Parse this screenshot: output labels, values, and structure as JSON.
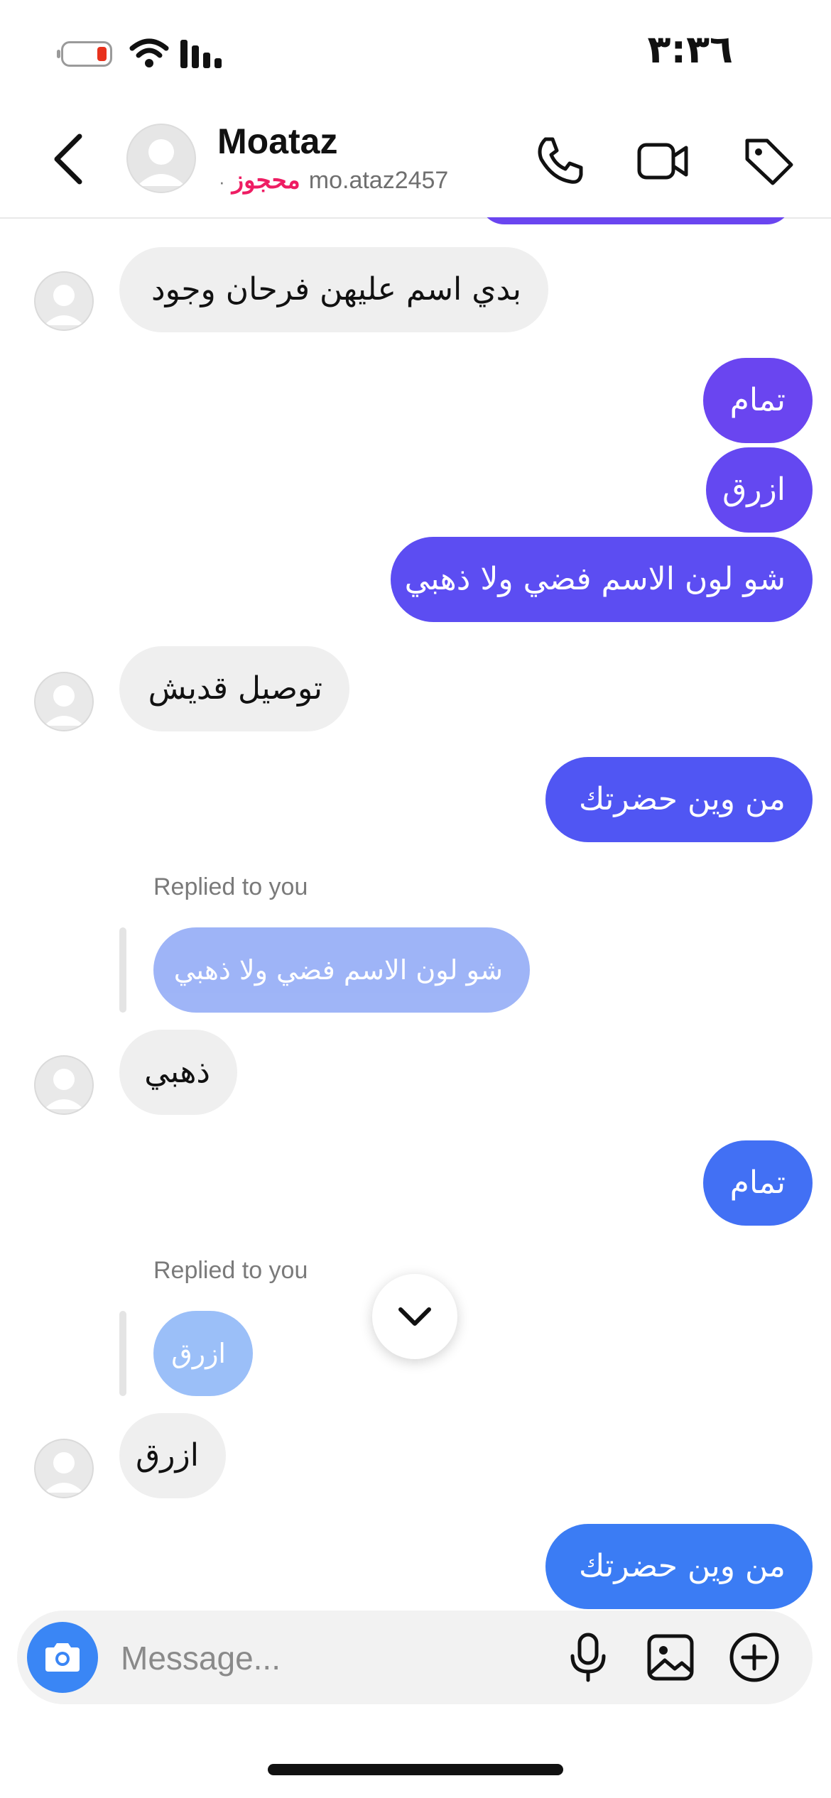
{
  "status_bar": {
    "time": "٣:٣٦"
  },
  "header": {
    "contact_name": "Moataz",
    "username": "mo.ataz2457",
    "status": "محجوز",
    "separator": "·"
  },
  "messages": [
    {
      "direction": "in",
      "text": "بدي اسم عليهن فرحان وجود"
    },
    {
      "direction": "out",
      "text": "تمام"
    },
    {
      "direction": "out",
      "text": "ازرق"
    },
    {
      "direction": "out",
      "text": "شو لون الاسم فضي ولا ذهبي"
    },
    {
      "direction": "in",
      "text": "توصيل قديش"
    },
    {
      "direction": "out",
      "text": "من وين حضرتك"
    },
    {
      "direction": "in",
      "replied_label": "Replied to you",
      "quoted": "شو لون الاسم فضي ولا ذهبي",
      "text": "ذهبي"
    },
    {
      "direction": "out",
      "text": "تمام"
    },
    {
      "direction": "in",
      "replied_label": "Replied to you",
      "quoted": "ازرق",
      "text": "ازرق"
    },
    {
      "direction": "out",
      "text": "من وين حضرتك"
    }
  ],
  "composer": {
    "placeholder": "Message..."
  },
  "colors": {
    "out_bubble_1": "#6a45f0",
    "out_bubble_2": "#5a4ff2",
    "out_bubble_3": "#4a63f3",
    "out_bubble_4": "#3b7cf4",
    "reply_quote_1": "#8ea8f6",
    "reply_quote_2": "#8ab4f7",
    "in_bubble": "#efefef",
    "status_pink": "#ee1d63",
    "camera_blue": "#3a86f5"
  }
}
